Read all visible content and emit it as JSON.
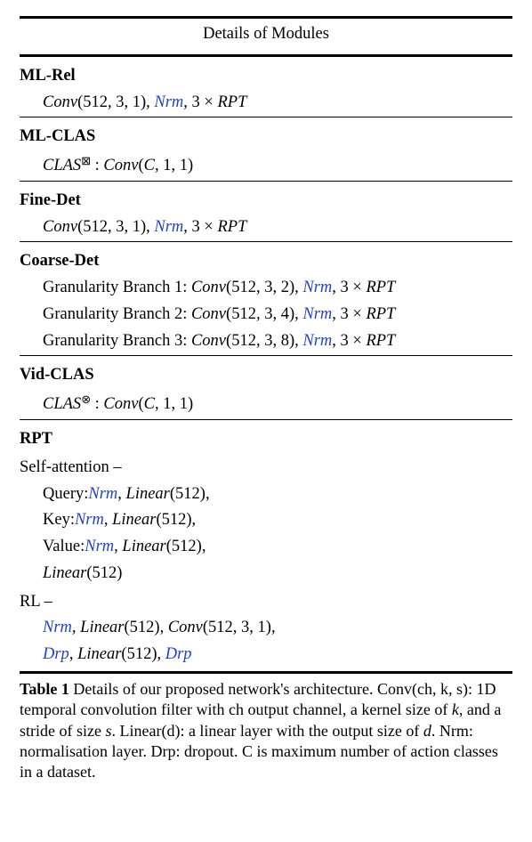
{
  "header": "Details of Modules",
  "modules": [
    {
      "name": "ML-Rel",
      "lines": [
        {
          "parts": [
            {
              "t": "it",
              "v": "Conv"
            },
            {
              "t": "",
              "v": "(512, 3, 1), "
            },
            {
              "t": "hlit",
              "v": "Nrm"
            },
            {
              "t": "",
              "v": ", 3 × "
            },
            {
              "t": "it",
              "v": "RPT"
            }
          ]
        }
      ]
    },
    {
      "name": "ML-CLAS",
      "lines": [
        {
          "parts": [
            {
              "t": "it",
              "v": "CLAS"
            },
            {
              "t": "sup",
              "v": "⊠"
            },
            {
              "t": "",
              "v": " : "
            },
            {
              "t": "it",
              "v": "Conv"
            },
            {
              "t": "",
              "v": "("
            },
            {
              "t": "it",
              "v": "C"
            },
            {
              "t": "",
              "v": ", 1, 1)"
            }
          ]
        }
      ]
    },
    {
      "name": "Fine-Det",
      "lines": [
        {
          "parts": [
            {
              "t": "it",
              "v": "Conv"
            },
            {
              "t": "",
              "v": "(512, 3, 1), "
            },
            {
              "t": "hlit",
              "v": "Nrm"
            },
            {
              "t": "",
              "v": ", 3 × "
            },
            {
              "t": "it",
              "v": "RPT"
            }
          ]
        }
      ]
    },
    {
      "name": "Coarse-Det",
      "lines": [
        {
          "parts": [
            {
              "t": "",
              "v": "Granularity Branch 1: "
            },
            {
              "t": "it",
              "v": "Conv"
            },
            {
              "t": "",
              "v": "(512, 3, 2), "
            },
            {
              "t": "hlit",
              "v": "Nrm"
            },
            {
              "t": "",
              "v": ", 3 × "
            },
            {
              "t": "it",
              "v": "RPT"
            }
          ]
        },
        {
          "parts": [
            {
              "t": "",
              "v": "Granularity Branch 2: "
            },
            {
              "t": "it",
              "v": "Conv"
            },
            {
              "t": "",
              "v": "(512, 3, 4), "
            },
            {
              "t": "hlit",
              "v": "Nrm"
            },
            {
              "t": "",
              "v": ", 3 × "
            },
            {
              "t": "it",
              "v": "RPT"
            }
          ]
        },
        {
          "parts": [
            {
              "t": "",
              "v": "Granularity Branch 3: "
            },
            {
              "t": "it",
              "v": "Conv"
            },
            {
              "t": "",
              "v": "(512, 3, 8), "
            },
            {
              "t": "hlit",
              "v": "Nrm"
            },
            {
              "t": "",
              "v": ", 3 × "
            },
            {
              "t": "it",
              "v": "RPT"
            }
          ]
        }
      ]
    },
    {
      "name": "Vid-CLAS",
      "lines": [
        {
          "parts": [
            {
              "t": "it",
              "v": "CLAS"
            },
            {
              "t": "sup",
              "v": "⊗"
            },
            {
              "t": "",
              "v": " : "
            },
            {
              "t": "it",
              "v": "Conv"
            },
            {
              "t": "",
              "v": "("
            },
            {
              "t": "it",
              "v": "C"
            },
            {
              "t": "",
              "v": ", 1, 1)"
            }
          ]
        }
      ]
    }
  ],
  "rpt": {
    "name": "RPT",
    "sections": [
      {
        "label": "Self-attention –",
        "lines": [
          {
            "parts": [
              {
                "t": "",
                "v": "Query:"
              },
              {
                "t": "hlit",
                "v": "Nrm"
              },
              {
                "t": "",
                "v": ", "
              },
              {
                "t": "it",
                "v": "Linear"
              },
              {
                "t": "",
                "v": "(512),"
              }
            ]
          },
          {
            "parts": [
              {
                "t": "",
                "v": "Key:"
              },
              {
                "t": "hlit",
                "v": "Nrm"
              },
              {
                "t": "",
                "v": ", "
              },
              {
                "t": "it",
                "v": "Linear"
              },
              {
                "t": "",
                "v": "(512),"
              }
            ]
          },
          {
            "parts": [
              {
                "t": "",
                "v": "Value:"
              },
              {
                "t": "hlit",
                "v": "Nrm"
              },
              {
                "t": "",
                "v": ", "
              },
              {
                "t": "it",
                "v": "Linear"
              },
              {
                "t": "",
                "v": "(512),"
              }
            ]
          },
          {
            "parts": [
              {
                "t": "it",
                "v": "Linear"
              },
              {
                "t": "",
                "v": "(512)"
              }
            ]
          }
        ]
      },
      {
        "label": "RL –",
        "lines": [
          {
            "parts": [
              {
                "t": "hlit",
                "v": "Nrm"
              },
              {
                "t": "",
                "v": ", "
              },
              {
                "t": "it",
                "v": "Linear"
              },
              {
                "t": "",
                "v": "(512), "
              },
              {
                "t": "it",
                "v": "Conv"
              },
              {
                "t": "",
                "v": "(512, 3, 1),"
              }
            ]
          },
          {
            "parts": [
              {
                "t": "hlit",
                "v": "Drp"
              },
              {
                "t": "",
                "v": ", "
              },
              {
                "t": "it",
                "v": "Linear"
              },
              {
                "t": "",
                "v": "(512), "
              },
              {
                "t": "hlit",
                "v": "Drp"
              }
            ]
          }
        ]
      }
    ]
  },
  "caption_label": "Table 1",
  "caption_parts": [
    {
      "t": "",
      "v": "  Details of our proposed network's architecture. Conv(ch, k, s): 1D temporal convolution filter with ch output channel, a kernel size of "
    },
    {
      "t": "it",
      "v": "k"
    },
    {
      "t": "",
      "v": ", and a stride of size "
    },
    {
      "t": "it",
      "v": "s"
    },
    {
      "t": "",
      "v": ". Linear(d): a linear layer with the output size of "
    },
    {
      "t": "it",
      "v": "d"
    },
    {
      "t": "",
      "v": ". Nrm: normalisation layer. Drp: dropout. C is maximum number of action classes in a dataset."
    }
  ]
}
